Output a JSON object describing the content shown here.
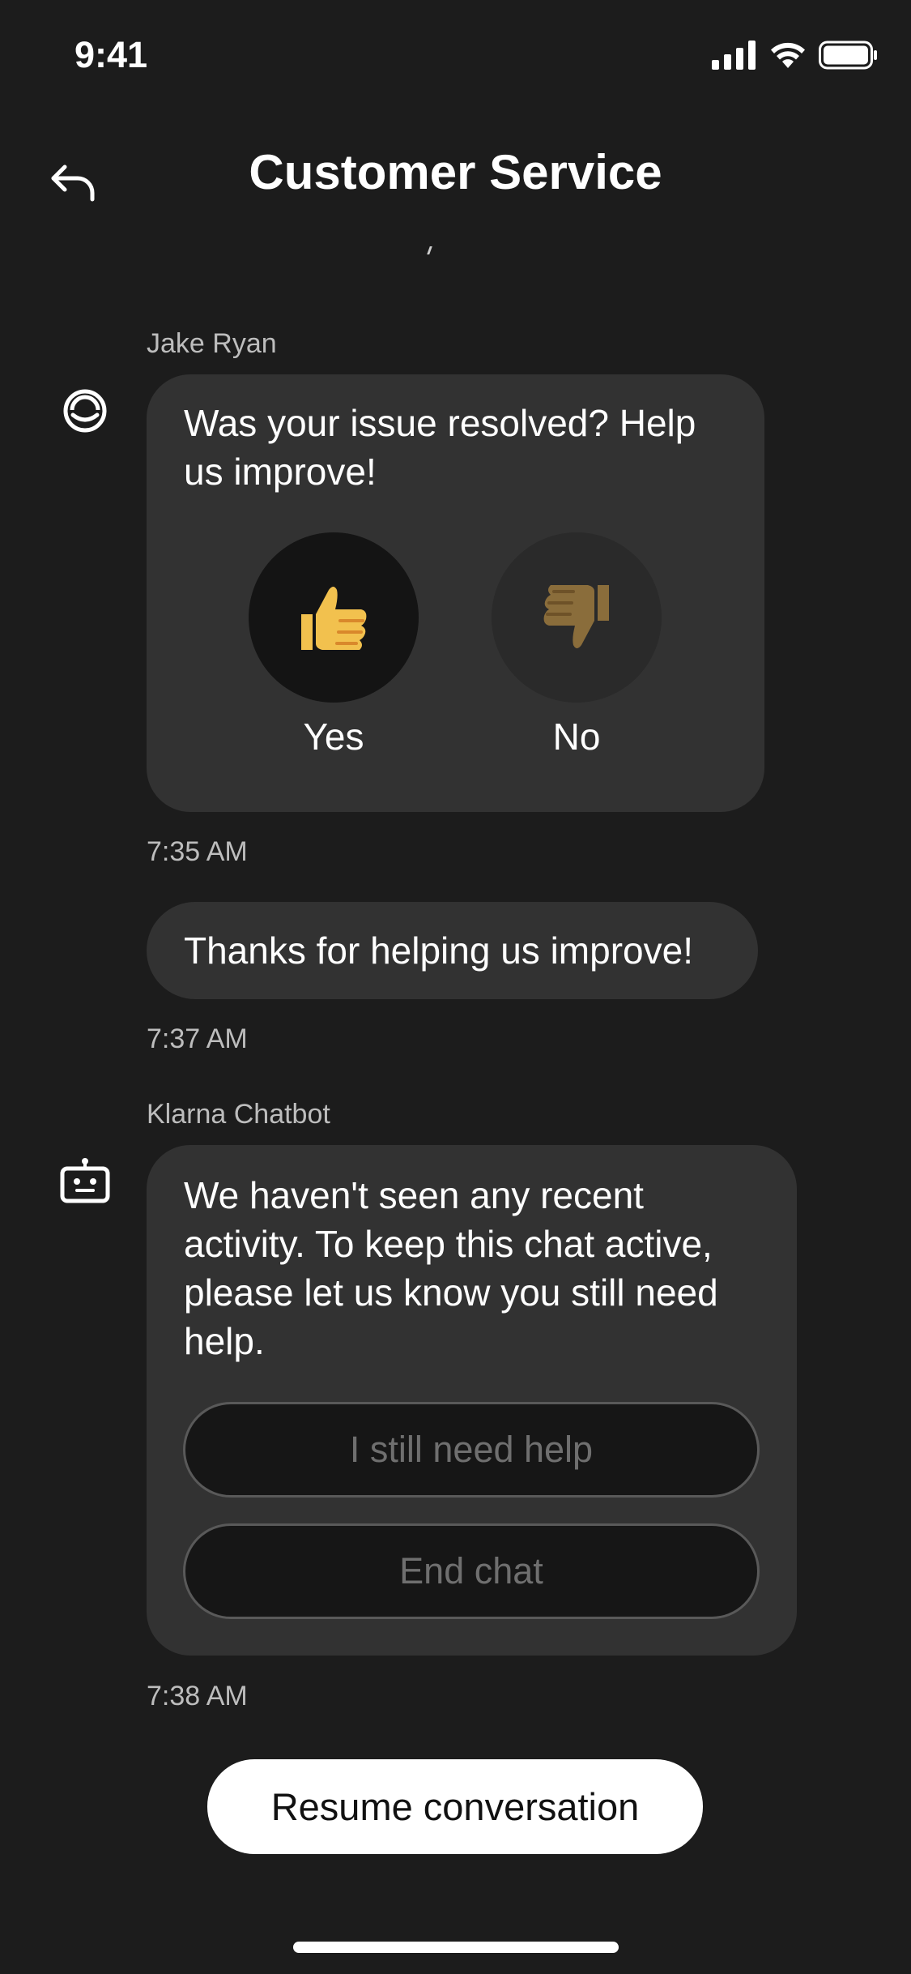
{
  "status_bar": {
    "time": "9:41"
  },
  "header": {
    "title": "Customer Service",
    "back_icon": "back-arrow-icon"
  },
  "messages": {
    "agent": {
      "sender": "Jake Ryan",
      "text": "Was your issue resolved? Help us improve!",
      "yes_label": "Yes",
      "no_label": "No",
      "timestamp": "7:35 AM"
    },
    "feedback": {
      "text": "Thanks for helping us improve!",
      "timestamp": "7:37 AM"
    },
    "bot": {
      "sender": "Klarna Chatbot",
      "text": "We haven't seen any recent activity. To keep this chat active, please let us know you still need help.",
      "button_help": "I still need help",
      "button_end": "End chat",
      "timestamp": "7:38 AM"
    }
  },
  "footer": {
    "resume_label": "Resume conversation"
  },
  "colors": {
    "background": "#1c1c1c",
    "bubble": "#323232",
    "thumb_yes": "#f2c14e",
    "thumb_no": "#8a6d3b"
  }
}
